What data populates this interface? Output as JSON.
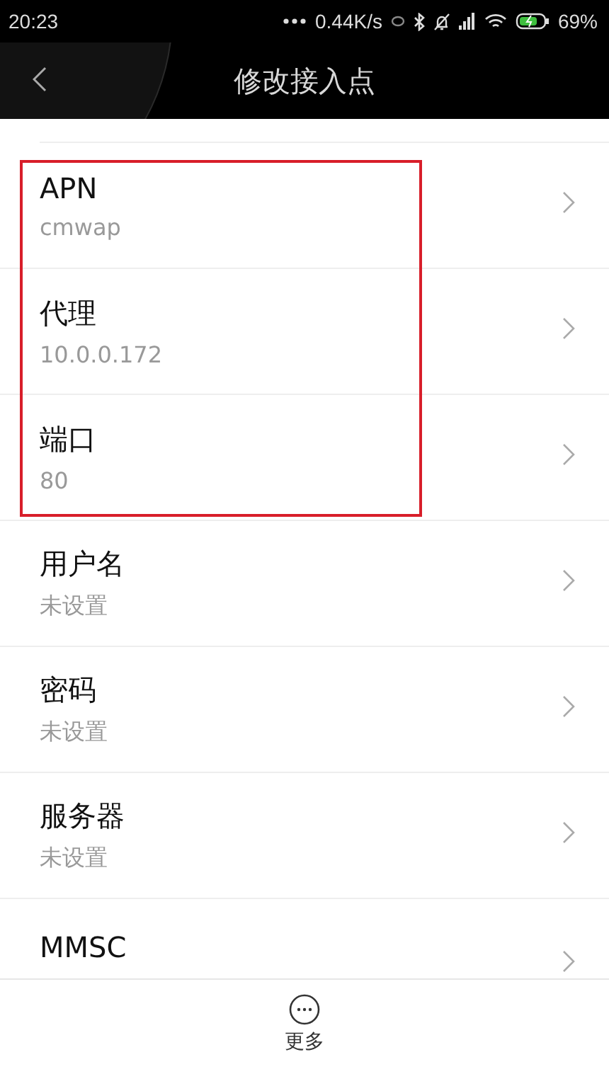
{
  "status_bar": {
    "time": "20:23",
    "speed": "0.44K/s",
    "battery": "69%"
  },
  "header": {
    "title": "修改接入点"
  },
  "settings": [
    {
      "label": "APN",
      "value": "cmwap",
      "highlighted": true
    },
    {
      "label": "代理",
      "value": "10.0.0.172",
      "highlighted": true
    },
    {
      "label": "端口",
      "value": "80",
      "highlighted": true
    },
    {
      "label": "用户名",
      "value": "未设置",
      "highlighted": false
    },
    {
      "label": "密码",
      "value": "未设置",
      "highlighted": false
    },
    {
      "label": "服务器",
      "value": "未设置",
      "highlighted": false
    },
    {
      "label": "MMSC",
      "highlighted": false
    }
  ],
  "bottom_bar": {
    "more_label": "更多"
  }
}
